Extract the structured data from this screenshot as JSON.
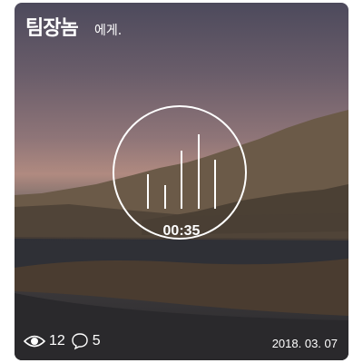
{
  "header": {
    "title": "팀장놈",
    "subtitle": "에게."
  },
  "player": {
    "time": "00:35",
    "progress": 0.65
  },
  "stats": {
    "views": "12",
    "comments": "5"
  },
  "date": "2018. 03. 07",
  "icons": {
    "views": "eye-icon",
    "comments": "speech-bubble-icon"
  },
  "colors": {
    "text": "#ffffff",
    "border": "#ffffff"
  }
}
